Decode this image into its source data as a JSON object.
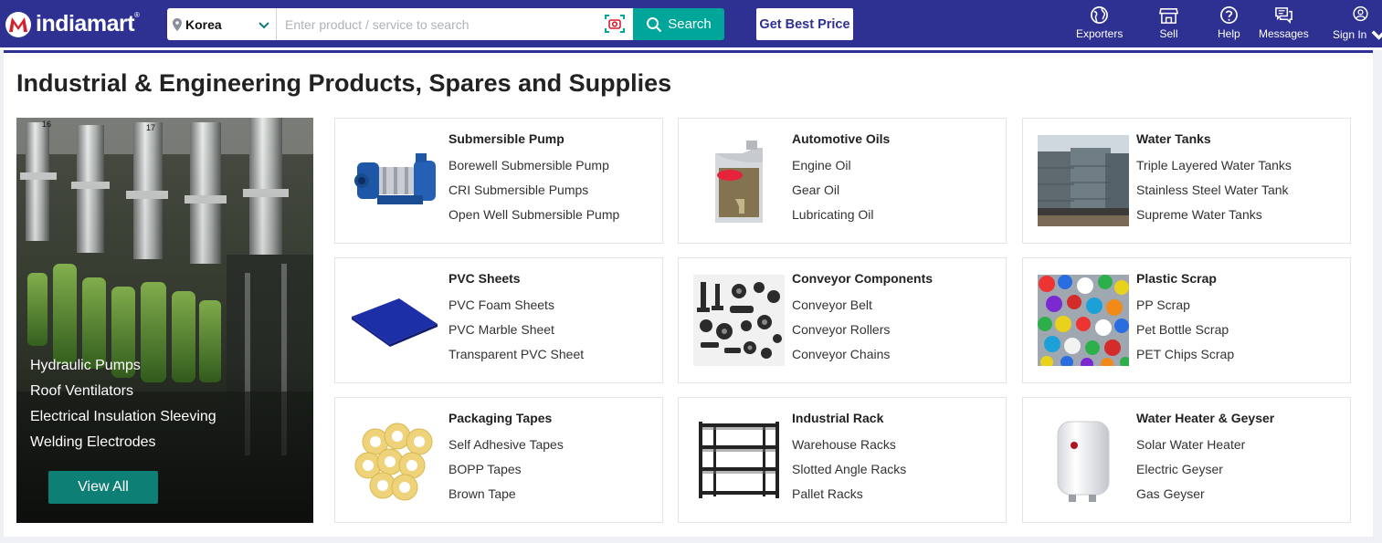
{
  "header": {
    "logo_text": "indiamart",
    "logo_reg": "®",
    "location": "Korea",
    "search_placeholder": "Enter product / service to search",
    "search_label": "Search",
    "best_price_label": "Get Best Price",
    "nav": [
      {
        "label": "Exporters",
        "icon": "globe-icon"
      },
      {
        "label": "Sell",
        "icon": "store-icon"
      },
      {
        "label": "Help",
        "icon": "help-icon"
      },
      {
        "label": "Messages",
        "icon": "messages-icon"
      },
      {
        "label": "Sign In",
        "icon": "user-icon"
      }
    ],
    "colors": {
      "brand": "#2e3192",
      "accent": "#00a699"
    }
  },
  "section": {
    "title": "Industrial & Engineering Products, Spares and Supplies",
    "hero_links": [
      "Hydraulic Pumps",
      "Roof Ventilators",
      "Electrical Insulation Sleeving",
      "Welding Electrodes"
    ],
    "view_all_label": "View All"
  },
  "cards": [
    {
      "title": "Submersible Pump",
      "links": [
        "Borewell Submersible Pump",
        "CRI Submersible Pumps",
        "Open Well Submersible Pump"
      ],
      "icon": "pump-image"
    },
    {
      "title": "Automotive Oils",
      "links": [
        "Engine Oil",
        "Gear Oil",
        "Lubricating Oil"
      ],
      "icon": "oil-can-image"
    },
    {
      "title": "Water Tanks",
      "links": [
        "Triple Layered Water Tanks",
        "Stainless Steel Water Tank",
        "Supreme Water Tanks"
      ],
      "icon": "water-tanks-image"
    },
    {
      "title": "PVC Sheets",
      "links": [
        "PVC Foam Sheets",
        "PVC Marble Sheet",
        "Transparent PVC Sheet"
      ],
      "icon": "pvc-sheet-image"
    },
    {
      "title": "Conveyor Components",
      "links": [
        "Conveyor Belt",
        "Conveyor Rollers",
        "Conveyor Chains"
      ],
      "icon": "conveyor-parts-image"
    },
    {
      "title": "Plastic Scrap",
      "links": [
        "PP Scrap",
        "Pet Bottle Scrap",
        "PET Chips Scrap"
      ],
      "icon": "plastic-scrap-image"
    },
    {
      "title": "Packaging Tapes",
      "links": [
        "Self Adhesive Tapes",
        "BOPP Tapes",
        "Brown Tape"
      ],
      "icon": "tape-rolls-image"
    },
    {
      "title": "Industrial Rack",
      "links": [
        "Warehouse Racks",
        "Slotted Angle Racks",
        "Pallet Racks"
      ],
      "icon": "rack-image"
    },
    {
      "title": "Water Heater & Geyser",
      "links": [
        "Solar Water Heater",
        "Electric Geyser",
        "Gas Geyser"
      ],
      "icon": "geyser-image"
    }
  ]
}
